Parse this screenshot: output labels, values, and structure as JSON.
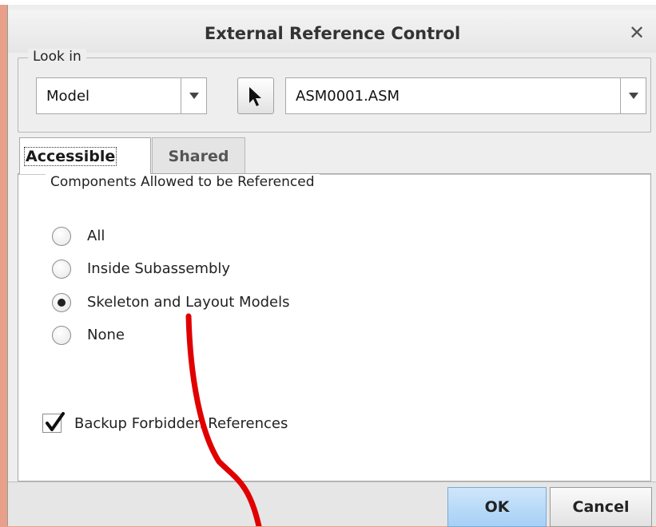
{
  "dialog": {
    "title": "External Reference Control"
  },
  "look_in": {
    "legend": "Look in",
    "scope_value": "Model",
    "model_value": "ASM0001.ASM"
  },
  "tabs": [
    {
      "label": "Accessible",
      "active": true
    },
    {
      "label": "Shared",
      "active": false
    }
  ],
  "components": {
    "legend": "Components Allowed to be Referenced",
    "options": [
      {
        "label": "All",
        "checked": false
      },
      {
        "label": "Inside Subassembly",
        "checked": false
      },
      {
        "label": "Skeleton and Layout Models",
        "checked": true
      },
      {
        "label": "None",
        "checked": false
      }
    ]
  },
  "backup": {
    "label": "Backup Forbidden References",
    "checked": true
  },
  "buttons": {
    "ok": "OK",
    "cancel": "Cancel"
  },
  "icons": {
    "close": "close-icon",
    "pick": "arrow-cursor-icon",
    "dropdown": "chevron-down-icon"
  },
  "colors": {
    "annotation": "#e00000",
    "ok_button": "#a6d0f5",
    "backdrop": "#e8a08a"
  }
}
